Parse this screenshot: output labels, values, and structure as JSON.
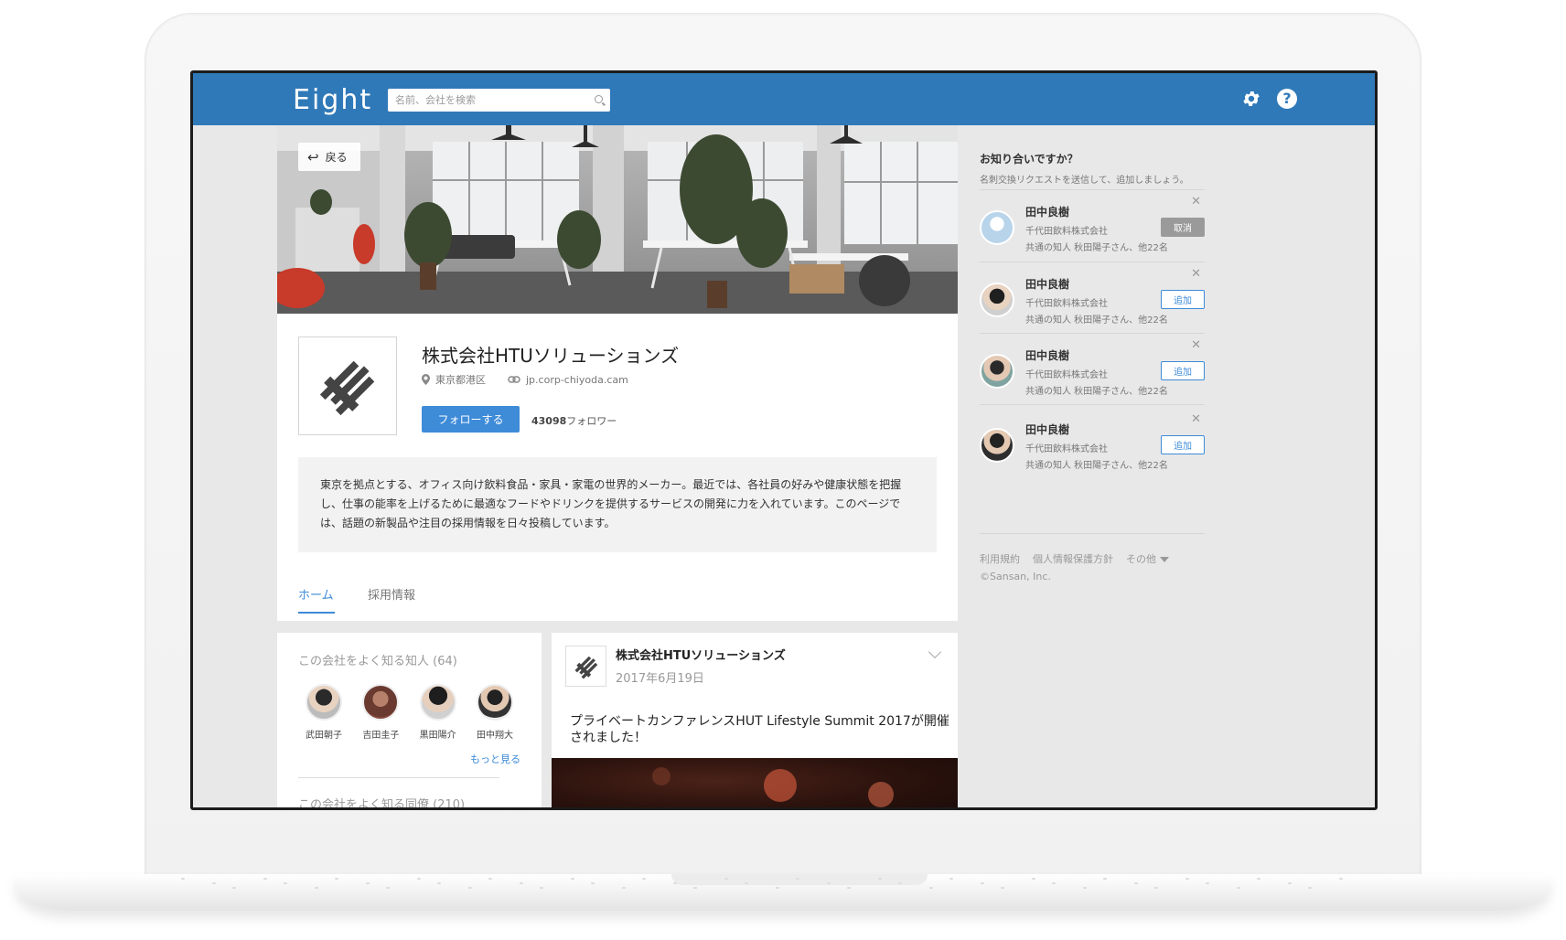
{
  "header": {
    "logo": "Eight",
    "search_placeholder": "名前、会社を検索"
  },
  "cover": {
    "back_label": "戻る"
  },
  "company": {
    "name": "株式会社HTUソリューションズ",
    "location": "東京都港区",
    "website": "jp.corp-chiyoda.cam",
    "follow_label": "フォローする",
    "follower_count": "43098",
    "follower_suffix": "フォロワー",
    "description": "東京を拠点とする、オフィス向け飲料食品・家具・家電の世界的メーカー。最近では、各社員の好みや健康状態を把握し、仕事の能率を上げるために最適なフードやドリンクを提供するサービスの開発に力を入れています。このページでは、話題の新製品や注目の採用情報を日々投稿しています。"
  },
  "tabs": [
    {
      "label": "ホーム",
      "active": true
    },
    {
      "label": "採用情報",
      "active": false
    }
  ],
  "acquaintances": {
    "title": "この会社をよく知る知人 (64)",
    "people": [
      {
        "name": "武田朝子"
      },
      {
        "name": "吉田圭子"
      },
      {
        "name": "黒田陽介"
      },
      {
        "name": "田中翔大"
      }
    ],
    "more_label": "もっと見る",
    "colleagues_title": "この会社をよく知る同僚 (210)"
  },
  "post": {
    "author": "株式会社HTUソリューションズ",
    "date": "2017年6月19日",
    "text": "プライベートカンファレンスHUT Lifestyle Summit 2017が開催されました！"
  },
  "sidebar": {
    "title": "お知り合いですか？",
    "subtitle": "名刺交換リクエストを送信して、追加しましょう。",
    "suggestions": [
      {
        "name": "田中良樹",
        "company": "千代田飲料株式会社",
        "mutual": "共通の知人 秋田陽子さん、他22名",
        "button": "取消",
        "state": "cancel"
      },
      {
        "name": "田中良樹",
        "company": "千代田飲料株式会社",
        "mutual": "共通の知人 秋田陽子さん、他22名",
        "button": "追加",
        "state": "add"
      },
      {
        "name": "田中良樹",
        "company": "千代田飲料株式会社",
        "mutual": "共通の知人 秋田陽子さん、他22名",
        "button": "追加",
        "state": "add"
      },
      {
        "name": "田中良樹",
        "company": "千代田飲料株式会社",
        "mutual": "共通の知人 秋田陽子さん、他22名",
        "button": "追加",
        "state": "add"
      }
    ],
    "footer": {
      "terms": "利用規約",
      "privacy": "個人情報保護方針",
      "other": "その他",
      "copyright": "©Sansan, Inc."
    }
  },
  "colors": {
    "header": "#3079b8",
    "accent": "#3e8bd8",
    "background": "#e8e8e8"
  }
}
